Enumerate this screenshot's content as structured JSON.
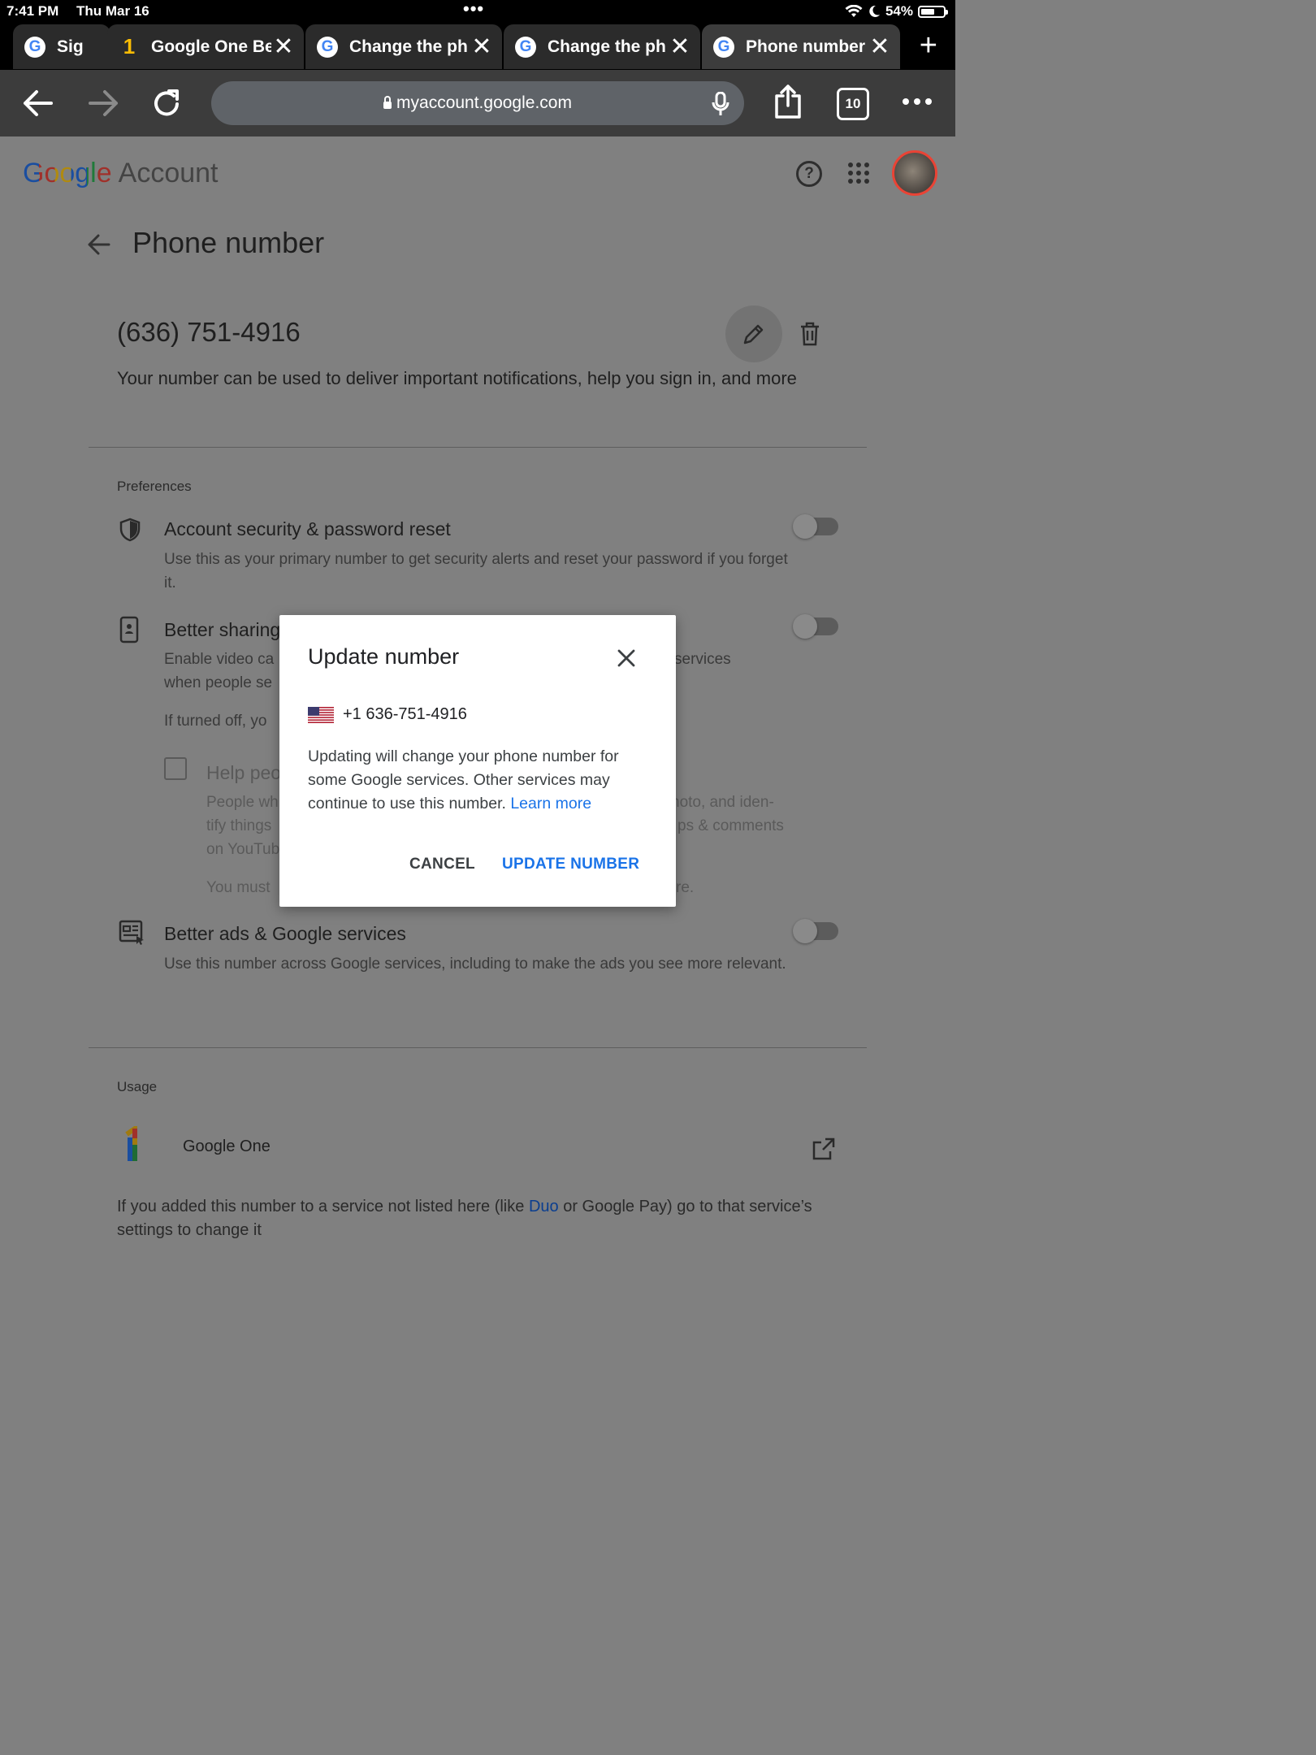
{
  "status_bar": {
    "time": "7:41 PM",
    "date": "Thu Mar 16",
    "battery": "54%",
    "battery_level": 0.54
  },
  "tabs": [
    {
      "label": "Sig",
      "favicon": "google-g-icon"
    },
    {
      "label": "Google One Be",
      "favicon": "google-one-icon"
    },
    {
      "label": "Change the ph",
      "favicon": "google-g-icon"
    },
    {
      "label": "Change the ph",
      "favicon": "google-g-icon"
    },
    {
      "label": "Phone number",
      "favicon": "google-g-icon",
      "active": true
    }
  ],
  "toolbar": {
    "url": "myaccount.google.com",
    "tab_count": "10"
  },
  "header": {
    "logo_google": "Google",
    "logo_account": "Account"
  },
  "page": {
    "title": "Phone number",
    "phone": "(636) 751-4916",
    "description": "Your number can be used to deliver important notifications, help you sign in, and more"
  },
  "preferences": {
    "label": "Preferences",
    "account_security": {
      "title": "Account security & password reset",
      "desc": "Use this as your primary number to get security alerts and reset your password if you forget it.",
      "enabled": false
    },
    "better_sharing": {
      "title": "Better sharing",
      "desc_start": "Enable video ca",
      "desc_end": "services",
      "desc_line2": "when people se",
      "note": "If turned off, yo",
      "enabled": false
    },
    "help_people": {
      "title": "Help peo",
      "desc_l1_start": "People wh",
      "desc_l1_end": "hoto, and iden-",
      "desc_l2_start": "tify things",
      "desc_l2_end": "ps & comments",
      "desc_l3": "on YouTub",
      "note_start": "You must",
      "note_end": "re."
    },
    "better_ads": {
      "title": "Better ads & Google services",
      "desc": "Use this number across Google services, including to make the ads you see more relevant.",
      "enabled": false
    }
  },
  "usage": {
    "label": "Usage",
    "item": "Google One",
    "footnote_a": "If you added this number to a service not listed here (like ",
    "footnote_link": "Duo",
    "footnote_b": " or Google Pay) go to that service’s settings to change it"
  },
  "dialog": {
    "title": "Update number",
    "phone": "+1 636-751-4916",
    "body": "Updating will change your phone number for some Google services. Other services may continue to use this number. ",
    "learn_more": "Learn more",
    "cancel": "CANCEL",
    "update": "UPDATE NUMBER"
  },
  "colors": {
    "accent": "#1a73e8",
    "scrim_page": "#808080",
    "tab_bg": "#2b2b2b",
    "toolbar_bg": "#3c3c3c"
  }
}
